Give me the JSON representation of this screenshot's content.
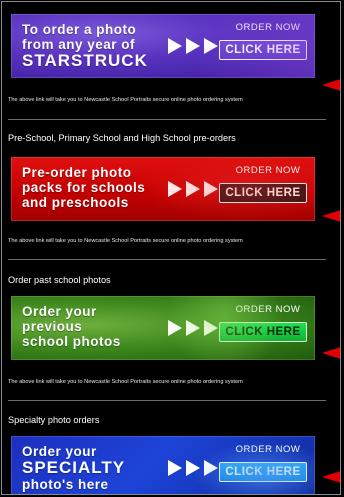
{
  "sections": [
    {
      "heading": "",
      "banner_lines": [
        "To order a photo",
        "from any year of",
        "STARSTRUCK"
      ],
      "order_now": "ORDER NOW",
      "click_label": "CLICK HERE",
      "note": "The above link will take you to Newcastle School Portraits secure online photo ordering system"
    },
    {
      "heading": "Pre-School, Primary School and High School pre-orders",
      "banner_lines": [
        "Pre-order photo",
        "packs for schools",
        "and preschools"
      ],
      "order_now": "ORDER NOW",
      "click_label": "CLICK HERE",
      "note": "The above link will take you to Newcastle School Portraits secure online photo ordering system"
    },
    {
      "heading": "Order past school photos",
      "banner_lines": [
        "Order your",
        "previous",
        "school photos"
      ],
      "order_now": "ORDER NOW",
      "click_label": "CLICK HERE",
      "note": "The above link will take you to Newcastle School Portraits secure online photo ordering system"
    },
    {
      "heading": "Specialty photo orders",
      "banner_lines": [
        "Order your",
        "SPECIALTY",
        "photo's here"
      ],
      "order_now": "ORDER NOW",
      "click_label": "CLICK HERE",
      "note": ""
    }
  ],
  "colors": {
    "accent_arrow": "#e00000",
    "divider": "#6b6b6b"
  }
}
